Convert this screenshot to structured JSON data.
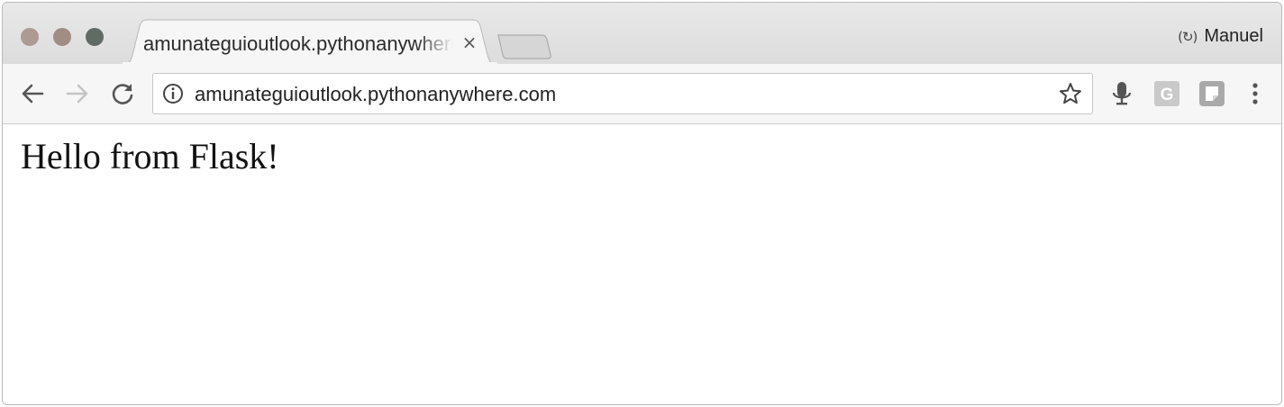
{
  "tab": {
    "title": "amunateguioutlook.pythonanywhere.com",
    "close_glyph": "×"
  },
  "profile": {
    "name": "Manuel",
    "sync_glyph": "(↻)"
  },
  "toolbar": {
    "back_icon": "arrow-left-icon",
    "forward_icon": "arrow-right-icon",
    "reload_icon": "reload-icon",
    "address": {
      "url": "amunateguioutlook.pythonanywhere.com",
      "info_icon": "info-icon",
      "bookmark_icon": "star-icon"
    },
    "extensions": [
      "microphone-icon",
      "g-extension-icon",
      "note-extension-icon",
      "menu-kebab-icon"
    ]
  },
  "page": {
    "text": "Hello from Flask!"
  },
  "colors": {
    "close": "#ae9a92",
    "minimize": "#a18d84",
    "maximize": "#5f6b64",
    "tabstrip": "#dcdcdc",
    "toolbar": "#f6f6f6"
  }
}
